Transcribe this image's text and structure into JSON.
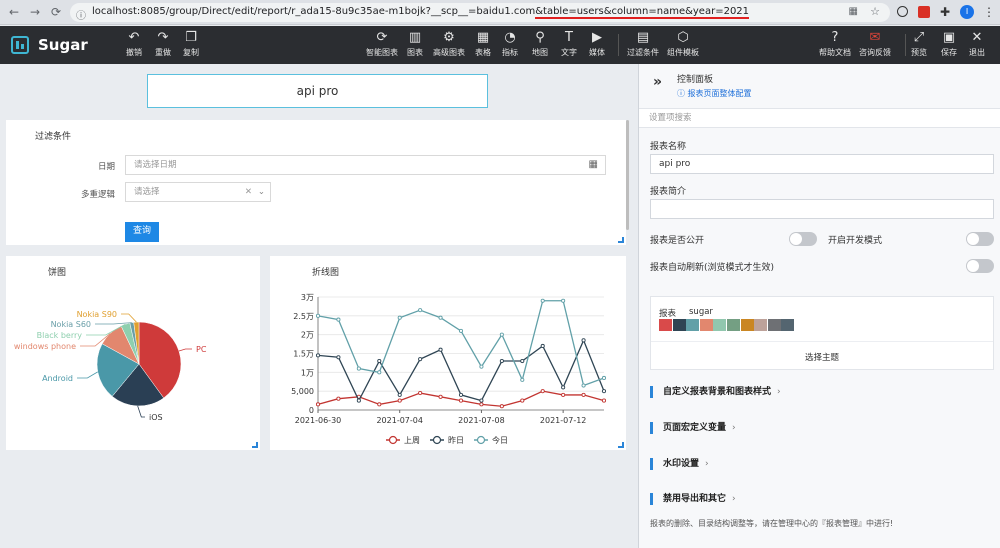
{
  "browser": {
    "url_prefix": "localhost:8085/group/Direct/edit/report/r_ada15-8u9c35ae-m1bojk?__scp__=baidu1.com",
    "url_highlight": "&table=users&column=name&year=2021",
    "profile_initial": "I"
  },
  "app": {
    "name": "Sugar",
    "toolbar_left": [
      {
        "label": "撤销",
        "icon": "undo-icon",
        "glyph": "↶"
      },
      {
        "label": "重做",
        "icon": "redo-icon",
        "glyph": "↷"
      },
      {
        "label": "复制",
        "icon": "copy-icon",
        "glyph": "❐"
      }
    ],
    "toolbar_center": [
      {
        "label": "智能图表",
        "icon": "smart-chart-icon",
        "glyph": "⟳"
      },
      {
        "label": "图表",
        "icon": "bar-chart-icon",
        "glyph": "▥"
      },
      {
        "label": "高级图表",
        "icon": "advanced-chart-icon",
        "glyph": "⚙"
      },
      {
        "label": "表格",
        "icon": "table-icon",
        "glyph": "▦"
      },
      {
        "label": "指标",
        "icon": "gauge-icon",
        "glyph": "◔"
      },
      {
        "label": "地图",
        "icon": "map-pin-icon",
        "glyph": "⚲"
      },
      {
        "label": "文字",
        "icon": "text-icon",
        "glyph": "T"
      },
      {
        "label": "媒体",
        "icon": "media-icon",
        "glyph": "▶"
      },
      {
        "label": "过滤条件",
        "icon": "filter-icon",
        "glyph": "▤"
      },
      {
        "label": "组件模板",
        "icon": "template-icon",
        "glyph": "⬡"
      }
    ],
    "toolbar_right": [
      {
        "label": "帮助文档",
        "icon": "help-icon",
        "glyph": "?"
      },
      {
        "label": "咨询反馈",
        "icon": "feedback-icon",
        "glyph": "✉"
      },
      {
        "label": "预览",
        "icon": "preview-icon",
        "glyph": "⤢"
      },
      {
        "label": "保存",
        "icon": "save-icon",
        "glyph": "▣"
      },
      {
        "label": "退出",
        "icon": "exit-icon",
        "glyph": "✕"
      }
    ]
  },
  "report": {
    "name": "api pro"
  },
  "filter": {
    "title": "过滤条件",
    "date_label": "日期",
    "date_placeholder": "请选择日期",
    "logic_label": "多重逻辑",
    "logic_placeholder": "请选择",
    "query_button": "查询"
  },
  "pie": {
    "title": "饼图"
  },
  "line": {
    "title": "折线图"
  },
  "chart_data": [
    {
      "type": "pie",
      "title": "饼图",
      "slices": [
        {
          "label": "PC",
          "value": 40,
          "color": "#cf3a3a"
        },
        {
          "label": "iOS",
          "value": 21,
          "color": "#2a3f54"
        },
        {
          "label": "Android",
          "value": 22,
          "color": "#4a98a8"
        },
        {
          "label": "windows phone",
          "value": 10,
          "color": "#e2876e"
        },
        {
          "label": "Black berry",
          "value": 3.5,
          "color": "#8ecfae"
        },
        {
          "label": "Nokia S60",
          "value": 1.5,
          "color": "#6a9fa8"
        },
        {
          "label": "Nokia S90",
          "value": 2,
          "color": "#e0a030"
        }
      ]
    },
    {
      "type": "line",
      "title": "折线图",
      "x": [
        "2021-06-30",
        "2021-07-01",
        "2021-07-02",
        "2021-07-03",
        "2021-07-04",
        "2021-07-05",
        "2021-07-06",
        "2021-07-07",
        "2021-07-08",
        "2021-07-09",
        "2021-07-10",
        "2021-07-11",
        "2021-07-12",
        "2021-07-13",
        "2021-07-14"
      ],
      "x_tick_labels": [
        "2021-06-30",
        "2021-07-04",
        "2021-07-08",
        "2021-07-12"
      ],
      "y_tick_labels": [
        "0",
        "5,000",
        "1万",
        "1.5万",
        "2万",
        "2.5万",
        "3万"
      ],
      "ylim": [
        0,
        30000
      ],
      "grid": true,
      "legend_position": "bottom",
      "series": [
        {
          "name": "上周",
          "color": "#c23531",
          "values": [
            1500,
            3000,
            3500,
            1500,
            2500,
            4500,
            3500,
            2500,
            1500,
            1000,
            2500,
            5000,
            4000,
            4000,
            2500
          ]
        },
        {
          "name": "昨日",
          "color": "#2f4554",
          "values": [
            14500,
            14000,
            2500,
            13000,
            4000,
            13500,
            16000,
            4000,
            2500,
            13000,
            13000,
            17000,
            6000,
            18500,
            5000
          ]
        },
        {
          "name": "今日",
          "color": "#61a0a8",
          "values": [
            25000,
            24000,
            11000,
            10000,
            24500,
            26500,
            24500,
            21000,
            11500,
            20000,
            8000,
            29000,
            29000,
            6500,
            8500
          ]
        }
      ]
    }
  ],
  "panel": {
    "title": "控制面板",
    "config_link": "报表页面整体配置",
    "search_placeholder": "设置项搜索",
    "name_label": "报表名称",
    "name_value": "api pro",
    "desc_label": "报表简介",
    "desc_value": "",
    "public_label": "报表是否公开",
    "devmode_label": "开启开发模式",
    "autorefresh_label": "报表自动刷新(浏览模式才生效)",
    "theme_label": "报表",
    "theme_name": "sugar",
    "theme_colors": [
      "#d94a4a",
      "#2f4554",
      "#61a0a8",
      "#e2876e",
      "#91c7ae",
      "#749f83",
      "#ca8622",
      "#bda29a",
      "#6e7074",
      "#546570"
    ],
    "select_theme": "选择主题",
    "sections": [
      {
        "label": "自定义报表背景和图表样式"
      },
      {
        "label": "页面宏定义变量"
      },
      {
        "label": "水印设置"
      },
      {
        "label": "禁用导出和其它"
      }
    ],
    "footer": "报表的删除、目录结构调整等，请在管理中心的『报表管理』中进行!"
  }
}
